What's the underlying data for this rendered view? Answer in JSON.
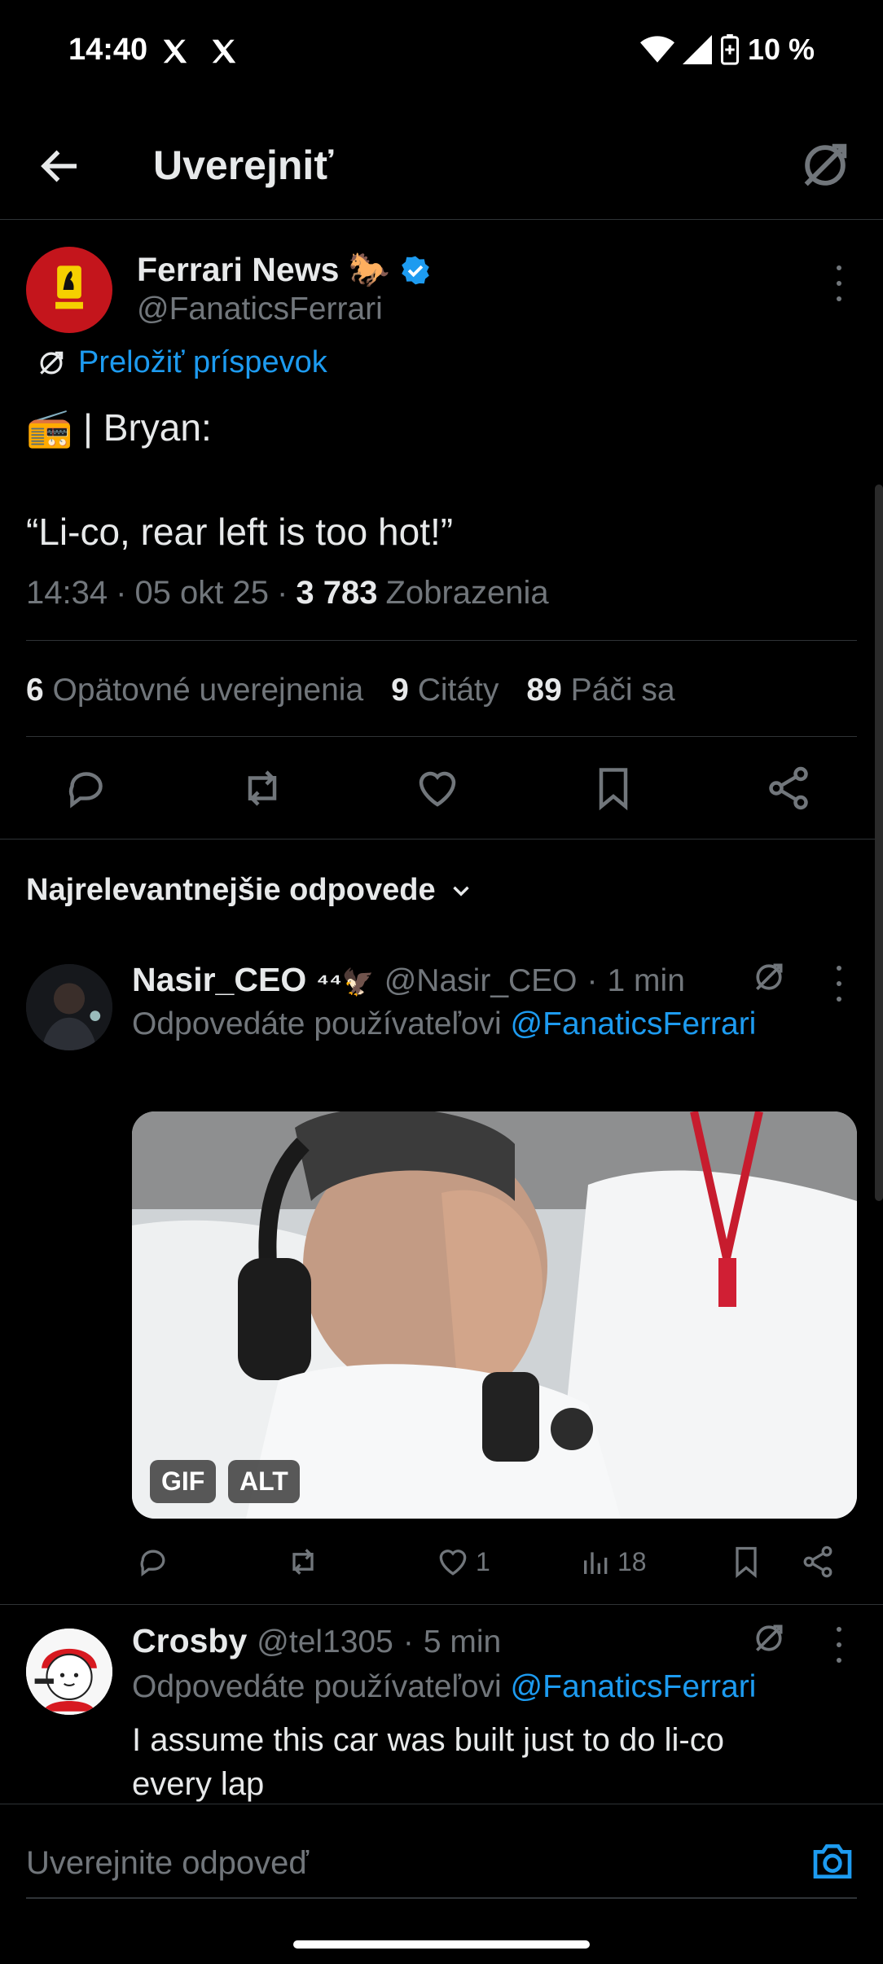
{
  "status_bar": {
    "time": "14:40",
    "battery": "10 %",
    "icons": [
      "x-logo-icon",
      "x-logo-icon",
      "wifi-icon",
      "signal-icon",
      "battery-icon"
    ]
  },
  "header": {
    "title": "Uverejniť",
    "back_icon": "arrow-left-icon",
    "translate_icon": "translate-icon"
  },
  "tweet": {
    "author_name": "Ferrari News 🐎",
    "handle": "@FanaticsFerrari",
    "verified": true,
    "translate_label": "Preložiť príspevok",
    "text_line1": "📻 | Bryan:",
    "text_line2": "“Li-co, rear left is too hot!”",
    "time": "14:34",
    "date": "05 okt 25",
    "views_count": "3 783",
    "views_label": "Zobrazenia",
    "stats": {
      "reposts_count": "6",
      "reposts_label": "Opätovné uverejnenia",
      "quotes_count": "9",
      "quotes_label": "Citáty",
      "likes_count": "89",
      "likes_label": "Páči sa"
    },
    "accent": "#1d9bf0"
  },
  "replies_sort": {
    "label": "Najrelevantnejšie odpovede"
  },
  "replies": [
    {
      "name": "Nasir_CEO",
      "name_suffix": "⁴⁴🦅",
      "handle": "@Nasir_CEO",
      "age": "1 min",
      "replying_to_prefix": "Odpovedáte používateľovi",
      "replying_to_handle": "@FanaticsFerrari",
      "media_badges": [
        "GIF",
        "ALT"
      ],
      "likes": "1",
      "views": "18"
    },
    {
      "name": "Crosby",
      "handle": "@tel1305",
      "age": "5 min",
      "replying_to_prefix": "Odpovedáte používateľovi",
      "replying_to_handle": "@FanaticsFerrari",
      "text_line1": "I assume this car was built just to do li-co",
      "text_line2": "every lap"
    }
  ],
  "composer": {
    "placeholder": "Uverejnite odpoveď",
    "camera_icon": "camera-icon"
  }
}
